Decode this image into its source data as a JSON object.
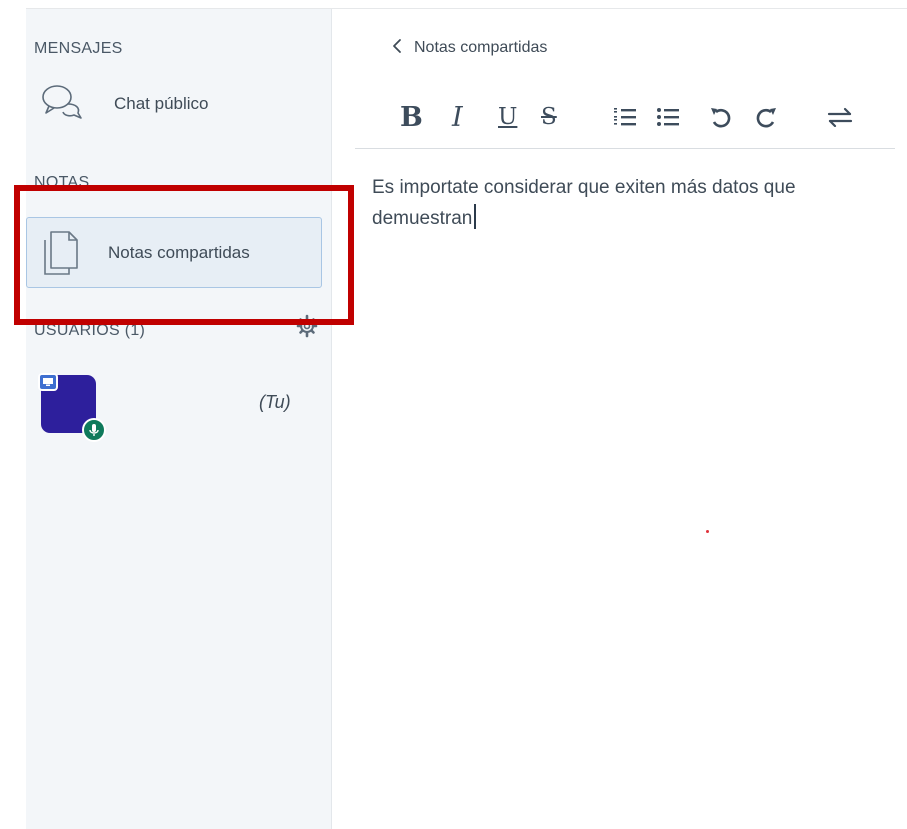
{
  "sidebar": {
    "messages_title": "MENSAJES",
    "public_chat_label": "Chat público",
    "notes_title": "NOTAS",
    "shared_notes_label": "Notas compartidas",
    "users_title": "USUARIOS (1)",
    "current_user_suffix": "(Tu)"
  },
  "notes_panel": {
    "back_label": "Notas compartidas",
    "toolbar": {
      "bold": "B",
      "italic": "I",
      "underline": "U",
      "strikethrough": "S"
    },
    "content": "Es importate considerar que exiten más datos que demuestran"
  },
  "icons": {
    "chat": "speech-bubbles-icon",
    "notes": "document-copy-icon",
    "back": "chevron-left-icon",
    "settings": "gear-icon",
    "presenter": "presenter-screen-icon",
    "microphone": "microphone-icon",
    "ordered_list": "ordered-list-icon",
    "unordered_list": "unordered-list-icon",
    "undo": "undo-icon",
    "redo": "redo-icon",
    "swap": "swap-arrows-icon"
  },
  "colors": {
    "sidebar_bg": "#f3f6f9",
    "selected_item_bg": "#e7eef5",
    "selected_item_border": "#a9c6e4",
    "highlight_annotation": "#c00000",
    "avatar_bg": "#2d1f9c",
    "mic_badge": "#0f7a5c",
    "presenter_badge": "#3e6fd0"
  }
}
